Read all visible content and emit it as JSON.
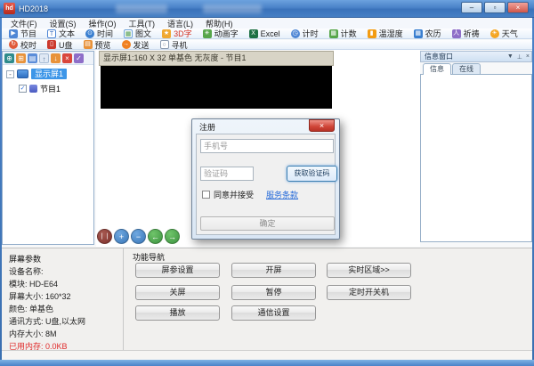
{
  "window": {
    "title": "HD2018",
    "minimize": "–",
    "maximize": "▫",
    "close": "×"
  },
  "menu": {
    "items": [
      "文件(F)",
      "设置(S)",
      "操作(O)",
      "工具(T)",
      "语言(L)",
      "帮助(H)"
    ]
  },
  "toolbar_primary": [
    {
      "label": "节目",
      "icon": "program-icon",
      "glyph": "▶"
    },
    {
      "label": "文本",
      "icon": "text-icon",
      "glyph": "T"
    },
    {
      "label": "时间",
      "icon": "time-icon",
      "glyph": "⊙"
    },
    {
      "label": "图文",
      "icon": "image-text-icon",
      "glyph": "▦"
    },
    {
      "label": "3D字",
      "icon": "3d-text-icon",
      "glyph": "★"
    },
    {
      "label": "动画字",
      "icon": "animated-text-icon",
      "glyph": "✳"
    },
    {
      "label": "Excel",
      "icon": "excel-icon",
      "glyph": "X"
    },
    {
      "label": "计时",
      "icon": "timer-icon",
      "glyph": "◷"
    },
    {
      "label": "计数",
      "icon": "counter-icon",
      "glyph": "▦"
    },
    {
      "label": "温湿度",
      "icon": "temperature-humidity-icon",
      "glyph": "▮"
    },
    {
      "label": "农历",
      "icon": "lunar-calendar-icon",
      "glyph": "▦"
    },
    {
      "label": "祈祷",
      "icon": "prayer-icon",
      "glyph": "人"
    },
    {
      "label": "天气",
      "icon": "weather-icon",
      "glyph": "☀"
    }
  ],
  "toolbar_secondary": [
    {
      "label": "校时",
      "icon": "time-sync-icon",
      "glyph": "↻"
    },
    {
      "label": "U盘",
      "icon": "usb-drive-icon",
      "glyph": "▯"
    },
    {
      "label": "预览",
      "icon": "preview-icon",
      "glyph": "▤"
    },
    {
      "label": "发送",
      "icon": "send-icon",
      "glyph": "→"
    },
    {
      "label": "寻机",
      "icon": "find-device-icon",
      "glyph": "○"
    }
  ],
  "tree": {
    "toolbar": [
      {
        "name": "settings",
        "glyph": "⊕"
      },
      {
        "name": "copy",
        "glyph": "⊞"
      },
      {
        "name": "paste",
        "glyph": "▤"
      },
      {
        "name": "move-up",
        "glyph": "↑"
      },
      {
        "name": "move-down",
        "glyph": "↓"
      },
      {
        "name": "delete",
        "glyph": "×"
      },
      {
        "name": "select-all",
        "glyph": "✓"
      }
    ],
    "expander": "-",
    "root_label": "显示屏1",
    "child_checkbox": "✓",
    "child_label": "节目1"
  },
  "editor": {
    "caption": "显示屏1:160 X 32 单基色 无灰度 - 节目1",
    "playback": [
      {
        "name": "pause",
        "glyph": "❘❘"
      },
      {
        "name": "zoom-in",
        "glyph": "+"
      },
      {
        "name": "zoom-out",
        "glyph": "−"
      },
      {
        "name": "prev",
        "glyph": "←"
      },
      {
        "name": "next",
        "glyph": "→"
      }
    ]
  },
  "info_panel": {
    "title": "信息窗口",
    "controls": {
      "collapse": "▼",
      "pin": "⊥",
      "close": "×"
    },
    "tabs": [
      "信息",
      "在线"
    ]
  },
  "screen_params": {
    "title": "屏幕参数",
    "rows": [
      "设备名称:",
      "模块: HD-E64",
      "屏幕大小: 160*32",
      "颜色: 单基色",
      "通讯方式: U盘,以太网",
      "内存大小: 8M"
    ],
    "used_memory": "已用内存: 0.0KB"
  },
  "function_nav": {
    "title": "功能导航",
    "buttons": [
      "屏参设置",
      "开屏",
      "实时区域>>",
      "关屏",
      "暂停",
      "定时开关机",
      "播放",
      "通信设置"
    ]
  },
  "register_dialog": {
    "title": "注册",
    "close": "×",
    "phone_placeholder": "手机号",
    "code_placeholder": "验证码",
    "get_code_button": "获取验证码",
    "agree_label": "同意并接受",
    "terms_link": "服务条款",
    "ok_button": "确定"
  },
  "colors": {
    "titlebar_blue": "#4a82c8",
    "selection_blue": "#3d96e8",
    "link_blue": "#2a6dd9",
    "memory_red": "#e02a2a",
    "accent_border_blue": "#3c7fb1",
    "caption_tan": "#d8d4c6"
  }
}
